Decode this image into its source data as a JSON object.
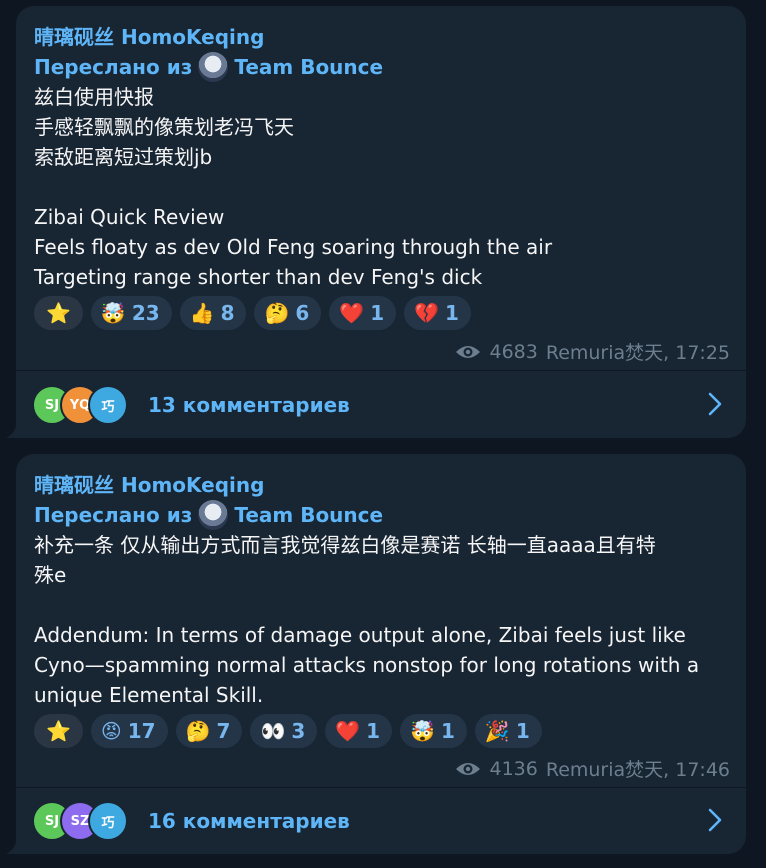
{
  "messages": [
    {
      "sender": "晴璃砚丝 HomoKeqing",
      "forward_prefix": "Переслано из",
      "forward_channel": "Team Bounce",
      "text": "兹白使用快报\n手感轻飘飘的像策划老冯飞天\n索敌距离短过策划jb\n\nZibai Quick Review\nFeels floaty as dev Old Feng soaring through the air\nTargeting range shorter than dev Feng's dick",
      "reactions": [
        {
          "emoji": "⭐",
          "count": ""
        },
        {
          "emoji": "🤯",
          "count": "23"
        },
        {
          "emoji": "👍",
          "count": "8"
        },
        {
          "emoji": "🤔",
          "count": "6"
        },
        {
          "emoji": "❤️",
          "count": "1"
        },
        {
          "emoji": "💔",
          "count": "1"
        }
      ],
      "views": "4683",
      "author": "Remuria焚天, 17:25",
      "comment_avatars": [
        {
          "initials": "SJ",
          "color": "#5cc85a"
        },
        {
          "initials": "YQ",
          "color": "#f0913a"
        },
        {
          "initials": "巧",
          "color": "#3ea9e0"
        }
      ],
      "comments_label": "13 комментариев"
    },
    {
      "sender": "晴璃砚丝 HomoKeqing",
      "forward_prefix": "Переслано из",
      "forward_channel": "Team Bounce",
      "text": "补充一条 仅从输出方式而言我觉得兹白像是赛诺 长轴一直aaaa且有特\n殊e\n\nAddendum: In terms of damage output alone, Zibai feels just like\nCyno—spamming normal attacks nonstop for long rotations with a\nunique Elemental Skill.",
      "reactions": [
        {
          "emoji": "⭐",
          "count": ""
        },
        {
          "emoji": "😡",
          "count": "17"
        },
        {
          "emoji": "🤔",
          "count": "7"
        },
        {
          "emoji": "👀",
          "count": "3"
        },
        {
          "emoji": "❤️",
          "count": "1"
        },
        {
          "emoji": "🤯",
          "count": "1"
        },
        {
          "emoji": "🎉",
          "count": "1"
        }
      ],
      "views": "4136",
      "author": "Remuria焚天, 17:46",
      "comment_avatars": [
        {
          "initials": "SJ",
          "color": "#5cc85a"
        },
        {
          "initials": "SZ",
          "color": "#8e6cf0"
        },
        {
          "initials": "巧",
          "color": "#3ea9e0"
        }
      ],
      "comments_label": "16 комментариев"
    }
  ],
  "colors": {
    "background": "#0e1621",
    "bubble": "#182533",
    "accent": "#5eb5f7",
    "meta": "#6d7f8f"
  }
}
